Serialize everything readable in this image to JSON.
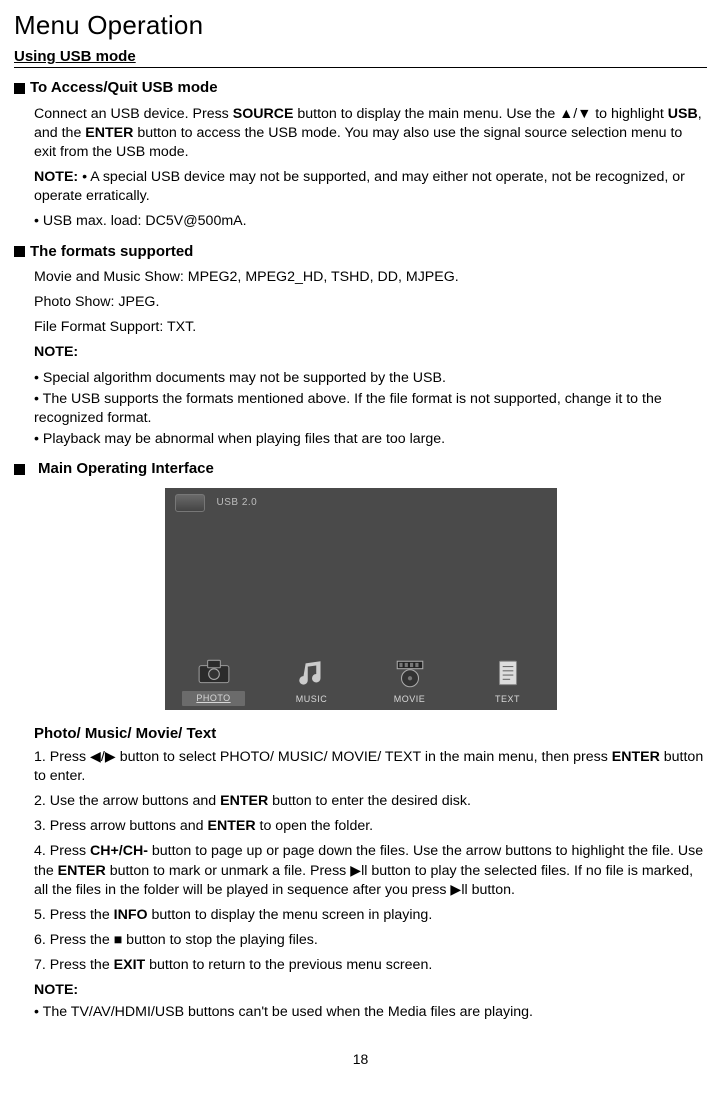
{
  "title": "Menu Operation",
  "subtitle": "Using USB mode",
  "sec1": {
    "heading": "To Access/Quit USB mode",
    "p1a": "Connect an USB device. Press ",
    "p1b": "SOURCE",
    "p1c": " button to display the main menu. Use the ",
    "p1d": "▲/▼",
    "p1e": " to highlight ",
    "p1f": "USB",
    "p1g": ", and the ",
    "p1h": "ENTER",
    "p1i": " button to access the USB mode. You may also use the signal source selection menu to exit from the USB mode.",
    "noteLabel": "NOTE:",
    "note1": " • A special USB device may not be supported, and may either not operate, not be recognized, or operate erratically.",
    "note2": "• USB max. load: DC5V@500mA."
  },
  "sec2": {
    "heading": "The formats supported",
    "line1": "Movie and Music Show: MPEG2, MPEG2_HD, TSHD, DD, MJPEG.",
    "line2": "Photo Show: JPEG.",
    "line3": "File Format Support: TXT.",
    "noteLabel": "NOTE:",
    "b1": "• Special algorithm documents may not be supported by the USB.",
    "b2": "• The USB supports the formats mentioned above. If the file format is not supported, change it to the recognized format.",
    "b3": "• Playback may be abnormal when playing files that are too large."
  },
  "sec3": {
    "heading": "Main Operating Interface"
  },
  "usbPanel": {
    "label": "USB 2.0",
    "items": [
      "PHOTO",
      "MUSIC",
      "MOVIE",
      "TEXT"
    ]
  },
  "sec4": {
    "heading": "Photo/ Music/ Movie/ Text",
    "s1a": "1. Press ",
    "s1b": "◀/▶",
    "s1c": " button to select PHOTO/ MUSIC/ MOVIE/ TEXT in the main menu, then press ",
    "s1d": "ENTER",
    "s1e": " button to enter.",
    "s2a": "2. Use the arrow buttons and ",
    "s2b": "ENTER",
    "s2c": " button to enter the desired disk.",
    "s3a": "3. Press arrow buttons and ",
    "s3b": "ENTER",
    "s3c": " to open the folder.",
    "s4a": "4. Press ",
    "s4b": "CH+/CH-",
    "s4c": " button to page up or page down the files. Use the arrow buttons to highlight the file. Use the ",
    "s4d": "ENTER",
    "s4e": " button to mark or unmark a file. Press ",
    "s4f": "▶ll",
    "s4g": " button to play the selected files. If no file is marked, all the files in the folder will be played in sequence after you press ",
    "s4h": "▶ll",
    "s4i": " button.",
    "s5a": "5. Press the ",
    "s5b": "INFO",
    "s5c": " button to display the menu screen in playing.",
    "s6a": "6. Press the ",
    "s6b": "■",
    "s6c": " button to stop the playing files.",
    "s7a": "7. Press the ",
    "s7b": "EXIT",
    "s7c": " button to return to the previous menu screen.",
    "noteLabel": "NOTE:",
    "note1": "• The TV/AV/HDMI/USB buttons can't be used when the Media files are playing."
  },
  "pageNumber": "18"
}
